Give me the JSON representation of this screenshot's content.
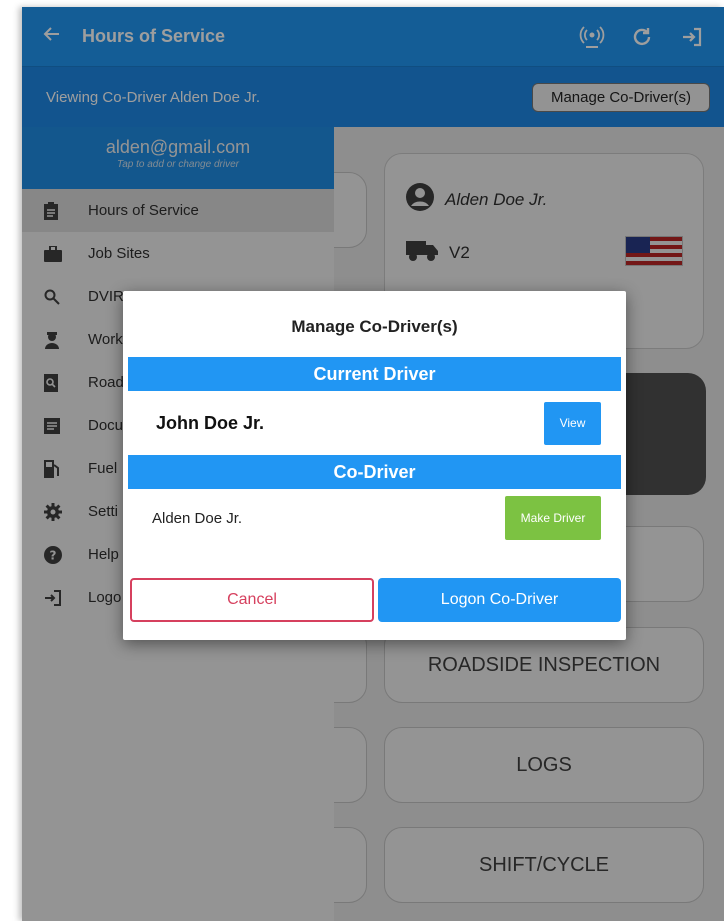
{
  "appbar": {
    "title": "Hours of Service"
  },
  "subbar": {
    "viewing": "Viewing Co-Driver Alden Doe Jr.",
    "manage_button": "Manage Co-Driver(s)"
  },
  "drawer": {
    "email": "alden@gmail.com",
    "tap_hint": "Tap to add or change driver",
    "items": [
      {
        "label": "Hours of Service",
        "icon": "clipboard-icon"
      },
      {
        "label": "Job Sites",
        "icon": "briefcase-icon"
      },
      {
        "label": "DVIR",
        "icon": "search-icon"
      },
      {
        "label": "Work",
        "icon": "worker-icon"
      },
      {
        "label": "Road",
        "icon": "inspection-icon"
      },
      {
        "label": "Docu",
        "icon": "document-icon"
      },
      {
        "label": "Fuel",
        "icon": "fuel-icon"
      },
      {
        "label": "Setti",
        "icon": "gear-icon"
      },
      {
        "label": "Help",
        "icon": "help-icon"
      },
      {
        "label": "Logo",
        "icon": "logout-icon"
      }
    ]
  },
  "main": {
    "driver_name": "Alden Doe Jr.",
    "vehicle": "V2",
    "buttons": [
      "ROADSIDE INSPECTION",
      "LOGS",
      "SHIFT/CYCLE"
    ]
  },
  "dialog": {
    "title": "Manage Co-Driver(s)",
    "current_header": "Current Driver",
    "current_name": "John Doe Jr.",
    "view_label": "View",
    "co_header": "Co-Driver",
    "co_name": "Alden Doe Jr.",
    "make_driver_label": "Make Driver",
    "cancel_label": "Cancel",
    "logon_label": "Logon Co-Driver"
  },
  "colors": {
    "primary": "#2196f3",
    "make_driver": "#7cc242",
    "cancel": "#d6405e"
  }
}
